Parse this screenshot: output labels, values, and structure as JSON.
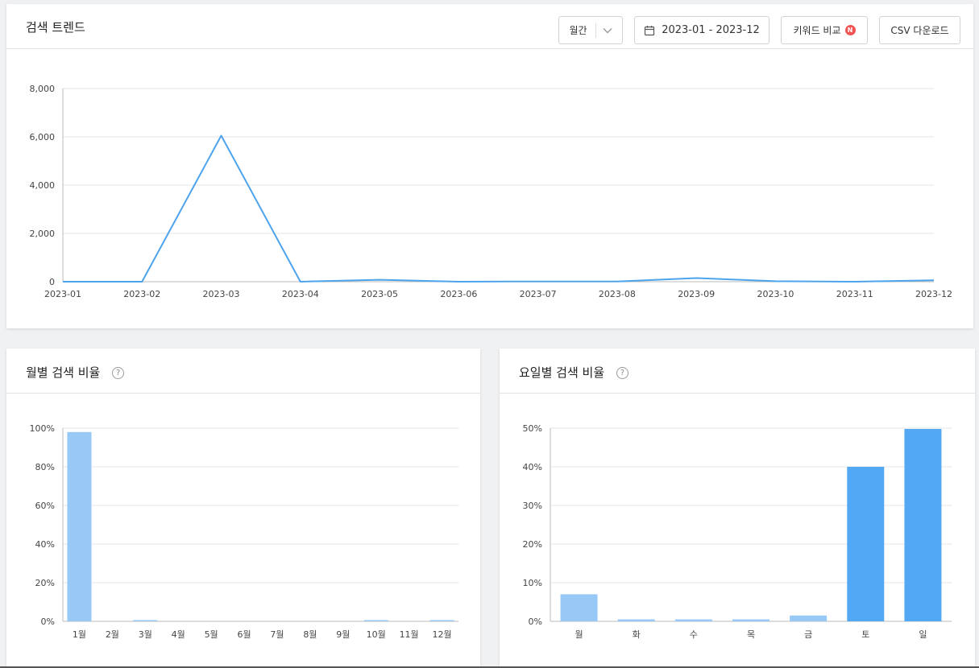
{
  "trend": {
    "title": "검색 트렌드",
    "period_select": "월간",
    "date_range": "2023-01 - 2023-12",
    "compare_label": "키워드 비교",
    "compare_badge": "N",
    "csv_label": "CSV 다운로드"
  },
  "monthly": {
    "title": "월별 검색 비율",
    "help": "?"
  },
  "weekday": {
    "title": "요일별 검색 비율",
    "help": "?"
  },
  "colors": {
    "line": "#4ea4ec",
    "bar_light": "#97c8f6",
    "bar_strong": "#52a8f2",
    "grid": "#e6e6e6"
  },
  "chart_data": [
    {
      "type": "line",
      "categories": [
        "2023-01",
        "2023-02",
        "2023-03",
        "2023-04",
        "2023-05",
        "2023-06",
        "2023-07",
        "2023-08",
        "2023-09",
        "2023-10",
        "2023-11",
        "2023-12"
      ],
      "values": [
        0,
        0,
        6050,
        0,
        80,
        0,
        10,
        10,
        150,
        20,
        0,
        60
      ],
      "ylim": [
        0,
        8000
      ],
      "yticks": [
        "0",
        "2,000",
        "4,000",
        "6,000",
        "8,000"
      ],
      "ytick_values": [
        0,
        2000,
        4000,
        6000,
        8000
      ],
      "grid": true
    },
    {
      "type": "bar",
      "categories": [
        "1월",
        "2월",
        "3월",
        "4월",
        "5월",
        "6월",
        "7월",
        "8월",
        "9월",
        "10월",
        "11월",
        "12월"
      ],
      "values": [
        98,
        0,
        0.1,
        0,
        0,
        0,
        0,
        0,
        0,
        0.6,
        0,
        0.4
      ],
      "ylim": [
        0,
        100
      ],
      "yticks": [
        "0%",
        "20%",
        "40%",
        "60%",
        "80%",
        "100%"
      ],
      "ytick_values": [
        0,
        20,
        40,
        60,
        80,
        100
      ],
      "grid": true
    },
    {
      "type": "bar",
      "categories": [
        "월",
        "화",
        "수",
        "목",
        "금",
        "토",
        "일"
      ],
      "values": [
        7,
        0.5,
        0.5,
        0.5,
        1.5,
        40,
        49.8
      ],
      "ylim": [
        0,
        50
      ],
      "yticks": [
        "0%",
        "10%",
        "20%",
        "30%",
        "40%",
        "50%"
      ],
      "ytick_values": [
        0,
        10,
        20,
        30,
        40,
        50
      ],
      "highlight": [
        false,
        false,
        false,
        false,
        false,
        true,
        true
      ],
      "grid": true
    }
  ]
}
